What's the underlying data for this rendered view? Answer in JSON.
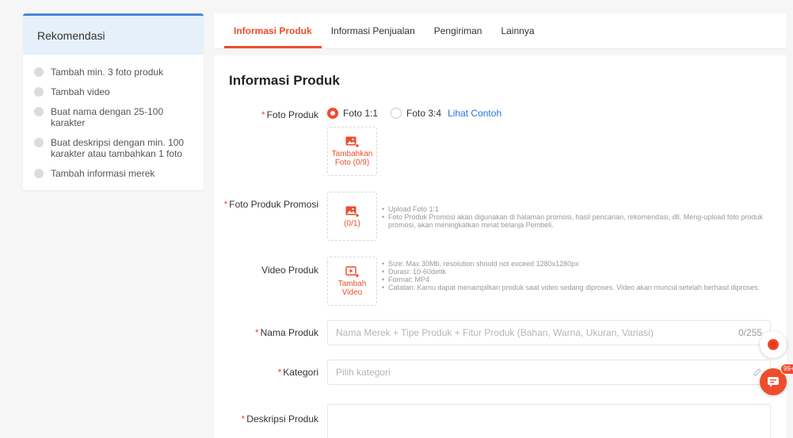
{
  "colors": {
    "accent": "#ee4d2d",
    "link": "#2673dd",
    "panel_head": "#e6f0fb"
  },
  "recommendation": {
    "title": "Rekomendasi",
    "items": [
      {
        "label": "Tambah min. 3 foto produk"
      },
      {
        "label": "Tambah video"
      },
      {
        "label": "Buat nama dengan 25-100 karakter"
      },
      {
        "label": "Buat deskripsi dengan min. 100 karakter atau tambahkan 1 foto"
      },
      {
        "label": "Tambah informasi merek"
      }
    ]
  },
  "tabs": [
    {
      "label": "Informasi Produk",
      "active": true
    },
    {
      "label": "Informasi Penjualan",
      "active": false
    },
    {
      "label": "Pengiriman",
      "active": false
    },
    {
      "label": "Lainnya",
      "active": false
    }
  ],
  "form": {
    "section_title": "Informasi Produk",
    "required_mark": "*",
    "foto_produk": {
      "label": "Foto Produk",
      "options": [
        "Foto 1:1",
        "Foto 3:4"
      ],
      "selected": "Foto 1:1",
      "example_link": "Lihat Contoh",
      "upload_label": "Tambahkan Foto (0/9)",
      "icon": "image-add-icon"
    },
    "foto_promosi": {
      "label": "Foto Produk Promosi",
      "upload_label": "(0/1)",
      "icon": "image-add-icon",
      "notes": [
        "Upload Foto 1:1",
        "Foto Produk Promosi akan digunakan di halaman promosi, hasil pencarian, rekomendasi, dll. Meng-upload foto produk promosi, akan meningkatkan minat belanja Pembeli."
      ]
    },
    "video_produk": {
      "label": "Video Produk",
      "upload_label": "Tambah Video",
      "icon": "video-add-icon",
      "notes": [
        "Size: Max 30Mb, resolution should not exceed 1280x1280px",
        "Durasi: 10-60detik",
        "Format: MP4",
        "Catatan: Kamu dapat menampilkan produk saat video sedang diproses. Video akan muncul setelah berhasil diproses."
      ]
    },
    "nama_produk": {
      "label": "Nama Produk",
      "value": "",
      "placeholder": "Nama Merek + Tipe Produk + Fitur Produk (Bahan, Warna, Ukuran, Variasi)",
      "counter": "0/255"
    },
    "kategori": {
      "label": "Kategori",
      "value": "",
      "placeholder": "Pilih kategori"
    },
    "deskripsi": {
      "label": "Deskripsi Produk"
    }
  },
  "floating": {
    "chat_badge": "99+"
  }
}
